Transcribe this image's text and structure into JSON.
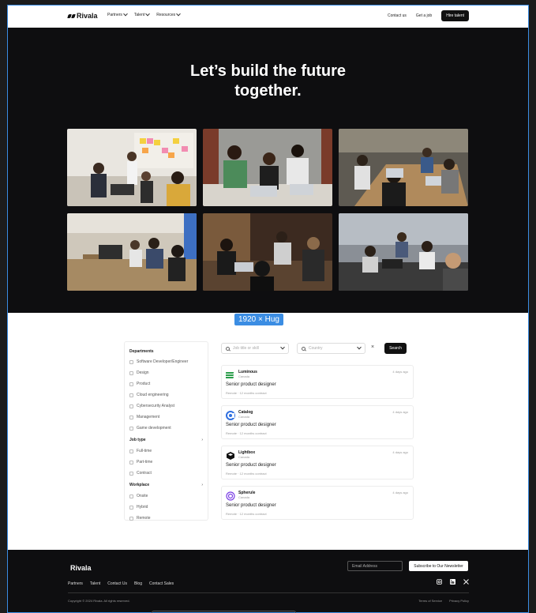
{
  "brand": {
    "name": "Rivala"
  },
  "nav": {
    "items": [
      {
        "label": "Partners"
      },
      {
        "label": "Talent"
      },
      {
        "label": "Resources"
      }
    ],
    "contact_label": "Contact us",
    "get_job_label": "Get a job",
    "hire_label": "Hire talent"
  },
  "hero": {
    "title_line1": "Let’s build the future",
    "title_line2": "together."
  },
  "frame_label": "1920 × Hug",
  "filters": {
    "departments_heading": "Departments",
    "departments": [
      "Software Developer/Engineer",
      "Design",
      "Product",
      "Cloud engineering",
      "Cybersecurity Analyst",
      "Management",
      "Game development"
    ],
    "job_type_heading": "Job type",
    "job_types": [
      "Full-time",
      "Part-time",
      "Contract"
    ],
    "workplace_heading": "Workplace",
    "workplaces": [
      "Onsite",
      "Hybrid",
      "Remote"
    ]
  },
  "search": {
    "job_placeholder": "Job title or skill",
    "country_placeholder": "Country",
    "button_label": "Search",
    "clear_symbol": "×"
  },
  "jobs": [
    {
      "company": "Luminous",
      "location": "Canada",
      "posted": "4 days ago",
      "title": "Senior product designer",
      "meta": "Remote · 12 months contract",
      "logo_color": "#2a9d4a"
    },
    {
      "company": "Catalog",
      "location": "Canada",
      "posted": "4 days ago",
      "title": "Senior product designer",
      "meta": "Remote · 12 months contract",
      "logo_color": "#2f6fe0"
    },
    {
      "company": "Lightbox",
      "location": "Canada",
      "posted": "4 days ago",
      "title": "Senior product designer",
      "meta": "Remote · 12 months contract",
      "logo_color": "#111111"
    },
    {
      "company": "Spherule",
      "location": "Canada",
      "posted": "4 days ago",
      "title": "Senior product designer",
      "meta": "Remote · 12 months contract",
      "logo_color": "#7b3fe4"
    }
  ],
  "footer": {
    "email_placeholder": "Email Address",
    "subscribe_label": "Subscribe to Our Newsletter",
    "links": [
      "Partners",
      "Talent",
      "Contact Us",
      "Blog",
      "Contact Sales"
    ],
    "copyright": "Copyright © 2024 Rivala. All rights reserved.",
    "terms": "Terms of Service",
    "privacy": "Privacy Policy"
  },
  "colors": {
    "accent": "#3b8de3",
    "dark": "#0e0e10"
  }
}
